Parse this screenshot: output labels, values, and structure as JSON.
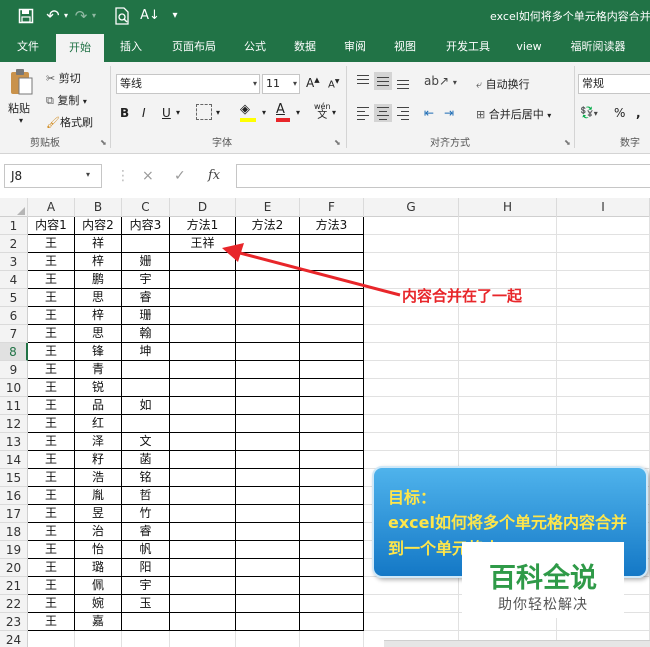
{
  "title_bar": {
    "doc_title": "excel如何将多个单元格内容合并",
    "icons": [
      "save-icon",
      "undo-icon",
      "redo-icon",
      "print-preview-icon",
      "sort-icon",
      "customize-icon"
    ]
  },
  "tabs": [
    "文件",
    "开始",
    "插入",
    "页面布局",
    "公式",
    "数据",
    "审阅",
    "视图",
    "开发工具",
    "view",
    "福昕阅读器"
  ],
  "active_tab": "开始",
  "ribbon": {
    "clipboard": {
      "paste": "粘贴",
      "cut": "剪切",
      "copy": "复制",
      "format_painter": "格式刷",
      "label": "剪贴板"
    },
    "font": {
      "family": "等线",
      "size": "11",
      "grow": "A",
      "shrink": "A",
      "bold": "B",
      "italic": "I",
      "underline": "U",
      "fill_color": "#ffff00",
      "font_color": "#e8262a",
      "phonetic_top": "wén",
      "phonetic_bottom": "文",
      "label": "字体"
    },
    "alignment": {
      "wrap": "自动换行",
      "merge": "合并后居中",
      "label": "对齐方式"
    },
    "number": {
      "format": "常规",
      "percent": "%",
      "comma": ",",
      "label": "数字"
    }
  },
  "formula_bar": {
    "name_box": "J8",
    "cancel": "×",
    "enter": "✓",
    "fx": "fx",
    "value": ""
  },
  "grid": {
    "columns": [
      "A",
      "B",
      "C",
      "D",
      "E",
      "F",
      "G",
      "H",
      "I"
    ],
    "selected_row": "8",
    "rows": [
      {
        "n": "1",
        "A": "内容1",
        "B": "内容2",
        "C": "内容3",
        "D": "方法1",
        "E": "方法2",
        "F": "方法3"
      },
      {
        "n": "2",
        "A": "王",
        "B": "祥",
        "C": "",
        "D": "王祥",
        "E": "",
        "F": ""
      },
      {
        "n": "3",
        "A": "王",
        "B": "梓",
        "C": "姗",
        "D": "",
        "E": "",
        "F": ""
      },
      {
        "n": "4",
        "A": "王",
        "B": "鹏",
        "C": "宇",
        "D": "",
        "E": "",
        "F": ""
      },
      {
        "n": "5",
        "A": "王",
        "B": "思",
        "C": "睿",
        "D": "",
        "E": "",
        "F": ""
      },
      {
        "n": "6",
        "A": "王",
        "B": "梓",
        "C": "珊",
        "D": "",
        "E": "",
        "F": ""
      },
      {
        "n": "7",
        "A": "王",
        "B": "思",
        "C": "翰",
        "D": "",
        "E": "",
        "F": ""
      },
      {
        "n": "8",
        "A": "王",
        "B": "锋",
        "C": "坤",
        "D": "",
        "E": "",
        "F": ""
      },
      {
        "n": "9",
        "A": "王",
        "B": "青",
        "C": "",
        "D": "",
        "E": "",
        "F": ""
      },
      {
        "n": "10",
        "A": "王",
        "B": "锐",
        "C": "",
        "D": "",
        "E": "",
        "F": ""
      },
      {
        "n": "11",
        "A": "王",
        "B": "品",
        "C": "如",
        "D": "",
        "E": "",
        "F": ""
      },
      {
        "n": "12",
        "A": "王",
        "B": "红",
        "C": "",
        "D": "",
        "E": "",
        "F": ""
      },
      {
        "n": "13",
        "A": "王",
        "B": "泽",
        "C": "文",
        "D": "",
        "E": "",
        "F": ""
      },
      {
        "n": "14",
        "A": "王",
        "B": "籽",
        "C": "菡",
        "D": "",
        "E": "",
        "F": ""
      },
      {
        "n": "15",
        "A": "王",
        "B": "浩",
        "C": "铭",
        "D": "",
        "E": "",
        "F": ""
      },
      {
        "n": "16",
        "A": "王",
        "B": "胤",
        "C": "哲",
        "D": "",
        "E": "",
        "F": ""
      },
      {
        "n": "17",
        "A": "王",
        "B": "昱",
        "C": "竹",
        "D": "",
        "E": "",
        "F": ""
      },
      {
        "n": "18",
        "A": "王",
        "B": "治",
        "C": "睿",
        "D": "",
        "E": "",
        "F": ""
      },
      {
        "n": "19",
        "A": "王",
        "B": "怡",
        "C": "帆",
        "D": "",
        "E": "",
        "F": ""
      },
      {
        "n": "20",
        "A": "王",
        "B": "璐",
        "C": "阳",
        "D": "",
        "E": "",
        "F": ""
      },
      {
        "n": "21",
        "A": "王",
        "B": "佩",
        "C": "宇",
        "D": "",
        "E": "",
        "F": ""
      },
      {
        "n": "22",
        "A": "王",
        "B": "婉",
        "C": "玉",
        "D": "",
        "E": "",
        "F": ""
      },
      {
        "n": "23",
        "A": "王",
        "B": "嘉",
        "C": "",
        "D": "",
        "E": "",
        "F": ""
      },
      {
        "n": "24",
        "A": "",
        "B": "",
        "C": "",
        "D": "",
        "E": "",
        "F": ""
      }
    ]
  },
  "annotation": {
    "text": "内容合并在了一起",
    "color": "#e8262a"
  },
  "goal_box": {
    "title": "目标：",
    "text": "excel如何将多个单元格内容合并到一个单元格中"
  },
  "watermark": {
    "title": "百科全说",
    "subtitle": "助你轻松解决"
  }
}
